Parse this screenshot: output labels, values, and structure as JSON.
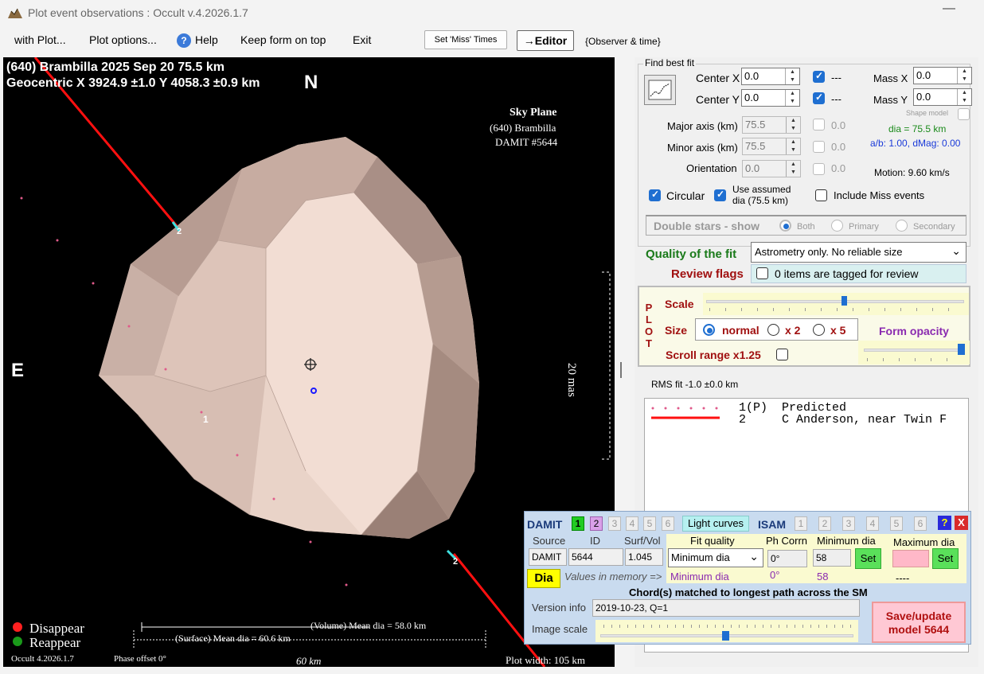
{
  "window": {
    "title": "Plot event observations : Occult v.4.2026.1.7",
    "minimize": "—"
  },
  "menu": {
    "with_plot": "with Plot...",
    "plot_options": "Plot options...",
    "help": "Help",
    "keep_on_top": "Keep form on top",
    "exit": "Exit",
    "set_miss_times": "Set 'Miss' Times",
    "editor": "→Editor",
    "observer_time": "{Observer & time}"
  },
  "plot": {
    "header1": "(640) Brambilla  2025 Sep 20   75.5 km",
    "header2": "Geocentric X  3924.9 ±1.0  Y 4058.3 ±0.9 km",
    "north": "N",
    "east": "E",
    "sky_plane": "Sky Plane",
    "sky_object": "(640) Brambilla",
    "sky_damit": "DAMIT #5644",
    "scale_label": "20 mas",
    "chord_label_1": "1",
    "chord_label_2": "2",
    "legend_disappear": "Disappear",
    "legend_reappear": "Reappear",
    "volume_dia": "(Volume) Mean dia = 58.0 km",
    "surface_dia": "(Surface) Mean dia = 60.6 km",
    "km_scale": "60 km",
    "footer_version": "Occult 4.2026.1.7",
    "phase_offset": "Phase offset 0°",
    "plot_width": "Plot width: 105 km",
    "colors": {
      "disappear": "#ff2020",
      "reappear": "#1a9a1a",
      "chord": "#ff0000",
      "shape": "#e8cfc3"
    }
  },
  "fit": {
    "group_title": "Find best fit",
    "center_x_label": "Center X",
    "center_x": "0.0",
    "center_y_label": "Center Y",
    "center_y": "0.0",
    "dash1": "---",
    "dash2": "---",
    "mass_x_label": "Mass X",
    "mass_x": "0.0",
    "mass_y_label": "Mass Y",
    "mass_y": "0.0",
    "shape_model": "Shape model",
    "major_label": "Major axis (km)",
    "major": "75.5",
    "minor_label": "Minor axis (km)",
    "minor": "75.5",
    "orient_label": "Orientation",
    "orient": "0.0",
    "val1": "0.0",
    "val2": "0.0",
    "val3": "0.0",
    "dia_text": "dia = 75.5 km",
    "ab_text": "a/b: 1.00, dMag: 0.00",
    "motion": "Motion: 9.60 km/s",
    "circular": "Circular",
    "use_assumed": "Use assumed dia (75.5 km)",
    "include_miss": "Include Miss events",
    "double_stars": "Double stars - show",
    "both": "Both",
    "primary": "Primary",
    "secondary": "Secondary",
    "quality_label": "Quality of the fit",
    "quality_value": "Astrometry only. No reliable size",
    "review_label": "Review flags",
    "review_value": "0 items are tagged for review"
  },
  "plotbox": {
    "plot_vertical": [
      "P",
      "L",
      "O",
      "T"
    ],
    "scale": "Scale",
    "size": "Size",
    "normal": "normal",
    "x2": "x 2",
    "x5": "x 5",
    "form_opacity": "Form opacity",
    "scroll_range": "Scroll range x1.25",
    "scale_level": 0.5,
    "opacity_level": 1.0
  },
  "rms": "RMS fit -1.0 ±0.0 km",
  "observers": [
    {
      "num": "1(P)",
      "name": "Predicted"
    },
    {
      "num": "2",
      "name": "C Anderson, near Twin F"
    }
  ],
  "damit": {
    "title": "DAMIT",
    "nums": [
      "1",
      "2",
      "3",
      "4",
      "5",
      "6"
    ],
    "light_curves": "Light curves",
    "isam": "ISAM",
    "isam_nums": [
      "1",
      "2",
      "3",
      "4",
      "5",
      "6"
    ],
    "help": "?",
    "close": "X",
    "source_h": "Source",
    "id_h": "ID",
    "surfvol_h": "Surf/Vol",
    "fitq_h": "Fit quality",
    "phcorr_h": "Ph Corrn",
    "mindia_h": "Minimum dia",
    "maxdia_h": "Maximum dia",
    "source": "DAMIT",
    "id": "5644",
    "surfvol": "1.045",
    "fitq": "Minimum dia",
    "phcorr": "0°",
    "mindia": "58",
    "set": "Set",
    "set2": "Set",
    "dia_btn": "Dia",
    "values_mem": "Values in memory =>",
    "mem_fitq": "Minimum dia",
    "mem_ph": "0°",
    "mem_min": "58",
    "mem_max": "----",
    "chord_msg": "Chord(s) matched to longest path across the SM",
    "version_label": "Version info",
    "version": "2019-10-23, Q=1",
    "image_scale": "Image scale",
    "save": "Save/update model 5644",
    "image_scale_level": 0.5
  }
}
